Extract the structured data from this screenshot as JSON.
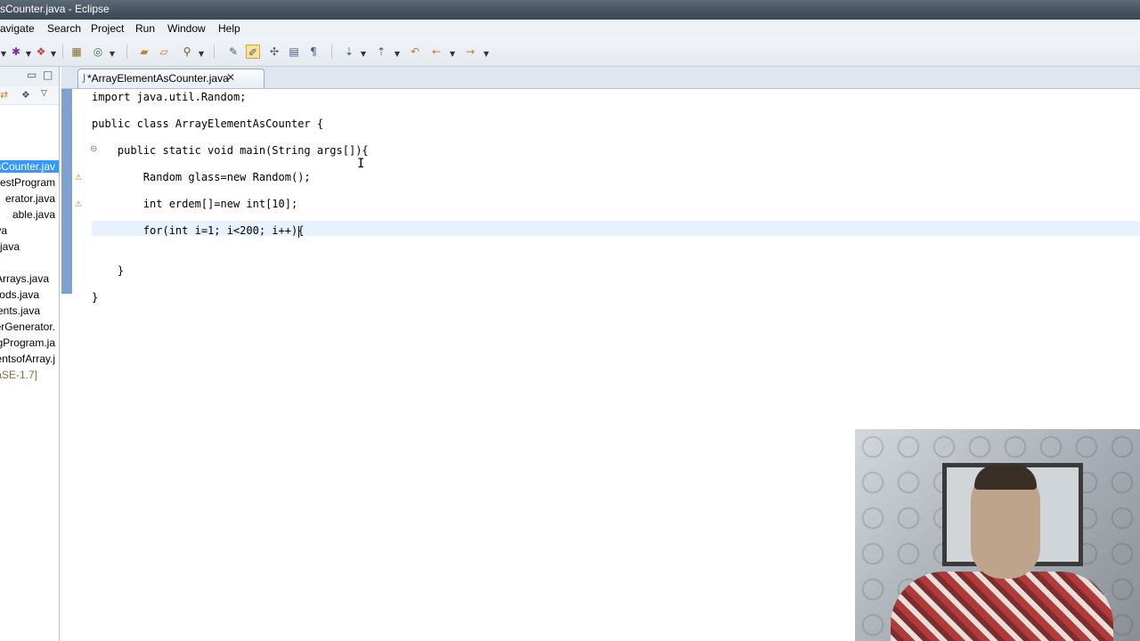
{
  "window": {
    "title": "sCounter.java - Eclipse"
  },
  "menu": {
    "items": [
      "avigate",
      "Search",
      "Project",
      "Run",
      "Window",
      "Help"
    ]
  },
  "toolbar": {
    "icons": [
      "debug-icon",
      "external-tools-icon",
      "new-java-package-icon",
      "new-java-class-icon",
      "open-type-icon",
      "open-task-icon",
      "search-icon",
      "toggle-mark-occurrences-icon",
      "toggle-highlight-icon",
      "toggle-block-selection-icon",
      "show-whitespace-icon",
      "next-annotation-icon",
      "previous-annotation-icon",
      "last-edit-location-icon",
      "back-icon",
      "forward-icon"
    ]
  },
  "package_explorer": {
    "files": [
      "sCounter.jav",
      "estProgram",
      "erator.java",
      "able.java",
      "va",
      "java",
      "Arrays.java",
      "ods.java",
      "ents.java",
      "erGenerator.",
      "gProgram.ja",
      "entsofArray.j",
      "aSE-1.7]"
    ]
  },
  "editor": {
    "tab_label": "*ArrayElementAsCounter.java",
    "close_glyph": "✕",
    "lines": [
      "import java.util.Random;",
      "public class ArrayElementAsCounter {",
      "    public static void main(String args[]){",
      "        Random glass=new Random();",
      "        int erdem[]=new int[10];",
      "        for(int i=1; i<200; i++){",
      "    }",
      "}"
    ]
  },
  "colors": {
    "ruler": "#7fa1cd",
    "selection": "#3399ff",
    "current_line": "#e8f2fe"
  }
}
